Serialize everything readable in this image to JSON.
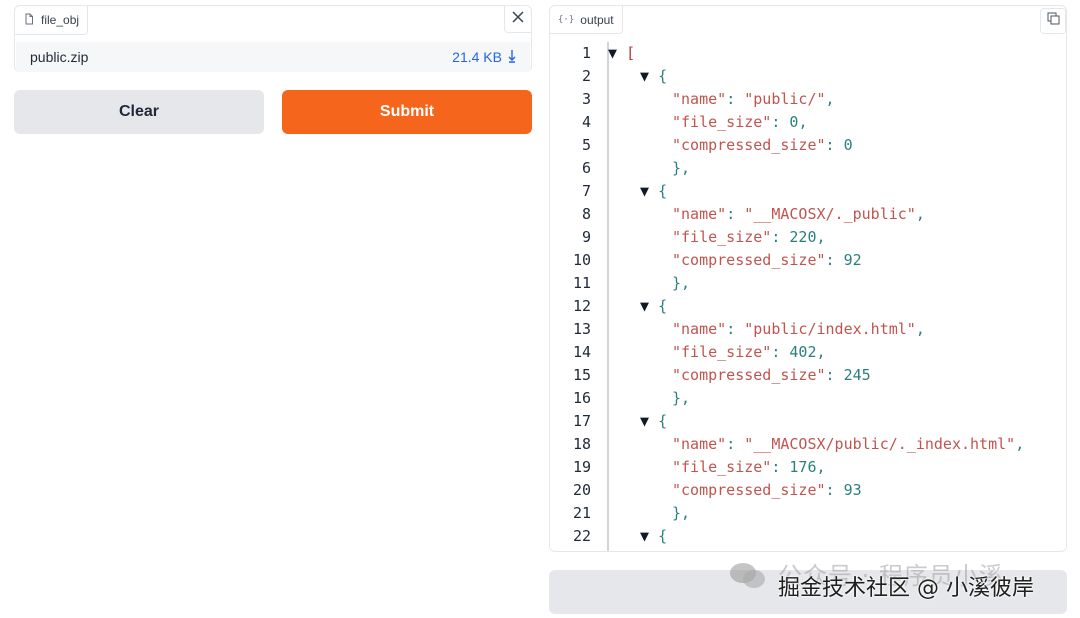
{
  "file_input": {
    "label": "file_obj",
    "file_name": "public.zip",
    "file_size": "21.4 KB"
  },
  "buttons": {
    "clear": "Clear",
    "submit": "Submit"
  },
  "output": {
    "label": "output",
    "lines": [
      {
        "n": "1",
        "indent": 0,
        "tri": true,
        "parts": [
          [
            "bracket",
            "["
          ]
        ]
      },
      {
        "n": "2",
        "indent": 1,
        "tri": true,
        "parts": [
          [
            "p",
            "{"
          ]
        ]
      },
      {
        "n": "3",
        "indent": 2,
        "tri": false,
        "parts": [
          [
            "k",
            "\"name\""
          ],
          [
            "p",
            ": "
          ],
          [
            "s",
            "\"public/\""
          ],
          [
            "p",
            ","
          ]
        ]
      },
      {
        "n": "4",
        "indent": 2,
        "tri": false,
        "parts": [
          [
            "k",
            "\"file_size\""
          ],
          [
            "p",
            ": "
          ],
          [
            "n",
            "0"
          ],
          [
            "p",
            ","
          ]
        ]
      },
      {
        "n": "5",
        "indent": 2,
        "tri": false,
        "parts": [
          [
            "k",
            "\"compressed_size\""
          ],
          [
            "p",
            ": "
          ],
          [
            "n",
            "0"
          ]
        ]
      },
      {
        "n": "6",
        "indent": 2,
        "tri": false,
        "parts": [
          [
            "p",
            "},"
          ]
        ]
      },
      {
        "n": "7",
        "indent": 1,
        "tri": true,
        "parts": [
          [
            "p",
            "{"
          ]
        ]
      },
      {
        "n": "8",
        "indent": 2,
        "tri": false,
        "parts": [
          [
            "k",
            "\"name\""
          ],
          [
            "p",
            ": "
          ],
          [
            "s",
            "\"__MACOSX/._public\""
          ],
          [
            "p",
            ","
          ]
        ]
      },
      {
        "n": "9",
        "indent": 2,
        "tri": false,
        "parts": [
          [
            "k",
            "\"file_size\""
          ],
          [
            "p",
            ": "
          ],
          [
            "n",
            "220"
          ],
          [
            "p",
            ","
          ]
        ]
      },
      {
        "n": "10",
        "indent": 2,
        "tri": false,
        "parts": [
          [
            "k",
            "\"compressed_size\""
          ],
          [
            "p",
            ": "
          ],
          [
            "n",
            "92"
          ]
        ]
      },
      {
        "n": "11",
        "indent": 2,
        "tri": false,
        "parts": [
          [
            "p",
            "},"
          ]
        ]
      },
      {
        "n": "12",
        "indent": 1,
        "tri": true,
        "parts": [
          [
            "p",
            "{"
          ]
        ]
      },
      {
        "n": "13",
        "indent": 2,
        "tri": false,
        "parts": [
          [
            "k",
            "\"name\""
          ],
          [
            "p",
            ": "
          ],
          [
            "s",
            "\"public/index.html\""
          ],
          [
            "p",
            ","
          ]
        ]
      },
      {
        "n": "14",
        "indent": 2,
        "tri": false,
        "parts": [
          [
            "k",
            "\"file_size\""
          ],
          [
            "p",
            ": "
          ],
          [
            "n",
            "402"
          ],
          [
            "p",
            ","
          ]
        ]
      },
      {
        "n": "15",
        "indent": 2,
        "tri": false,
        "parts": [
          [
            "k",
            "\"compressed_size\""
          ],
          [
            "p",
            ": "
          ],
          [
            "n",
            "245"
          ]
        ]
      },
      {
        "n": "16",
        "indent": 2,
        "tri": false,
        "parts": [
          [
            "p",
            "},"
          ]
        ]
      },
      {
        "n": "17",
        "indent": 1,
        "tri": true,
        "parts": [
          [
            "p",
            "{"
          ]
        ]
      },
      {
        "n": "18",
        "indent": 2,
        "tri": false,
        "parts": [
          [
            "k",
            "\"name\""
          ],
          [
            "p",
            ": "
          ],
          [
            "s",
            "\"__MACOSX/public/._index.html\""
          ],
          [
            "p",
            ","
          ]
        ]
      },
      {
        "n": "19",
        "indent": 2,
        "tri": false,
        "parts": [
          [
            "k",
            "\"file_size\""
          ],
          [
            "p",
            ": "
          ],
          [
            "n",
            "176"
          ],
          [
            "p",
            ","
          ]
        ]
      },
      {
        "n": "20",
        "indent": 2,
        "tri": false,
        "parts": [
          [
            "k",
            "\"compressed_size\""
          ],
          [
            "p",
            ": "
          ],
          [
            "n",
            "93"
          ]
        ]
      },
      {
        "n": "21",
        "indent": 2,
        "tri": false,
        "parts": [
          [
            "p",
            "},"
          ]
        ]
      },
      {
        "n": "22",
        "indent": 1,
        "tri": true,
        "parts": [
          [
            "p",
            "{"
          ]
        ]
      }
    ]
  },
  "flag_button": "",
  "watermark": {
    "line1": "公众号 · 程序员小溪",
    "line2": "掘金技术社区 @ 小溪彼岸"
  },
  "colors": {
    "submit": "#f5651c",
    "secondary_button": "#e5e7eb",
    "file_size": "#2563eb"
  }
}
